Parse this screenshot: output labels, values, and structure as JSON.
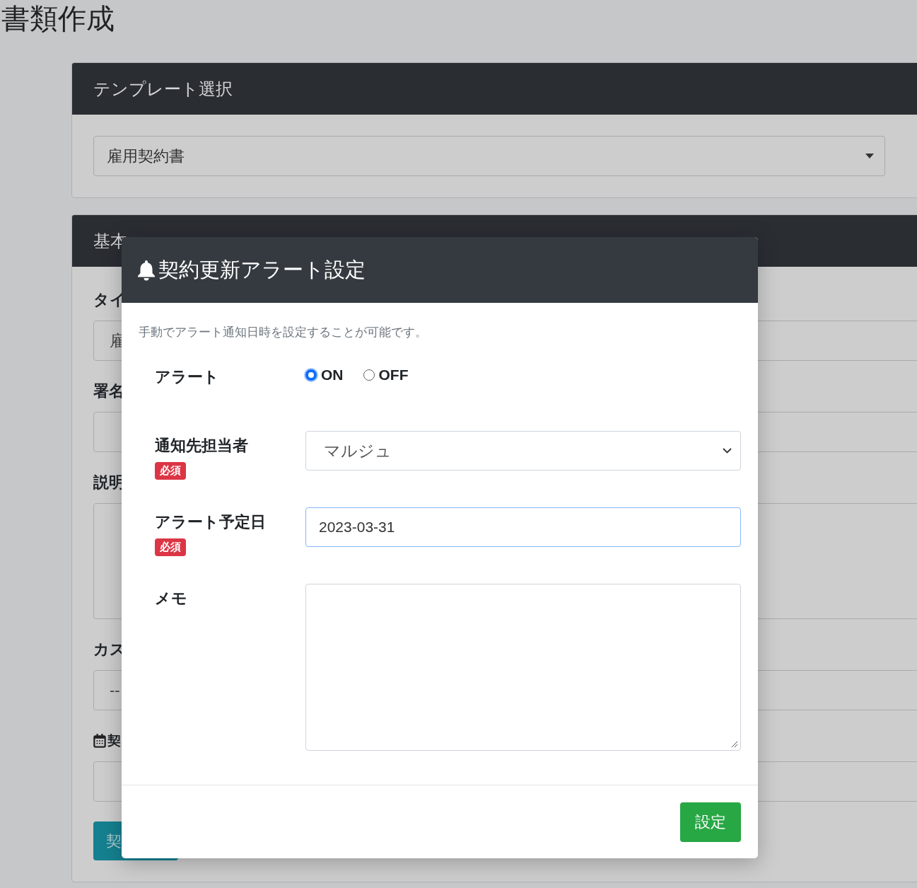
{
  "page_title": "書類作成",
  "template_card": {
    "title": "テンプレート選択",
    "select": {
      "value": "雇用契約書"
    }
  },
  "basic_card": {
    "title": "基本",
    "fields": [
      {
        "kind": "input",
        "label": "タイ",
        "value": "雇"
      },
      {
        "kind": "input",
        "label": "署名"
      },
      {
        "kind": "textarea",
        "label": "説明"
      },
      {
        "kind": "input",
        "label": "カス",
        "value": "--"
      },
      {
        "kind": "date",
        "label": "契"
      }
    ],
    "button": "契"
  },
  "modal": {
    "title": "契約更新アラート設定",
    "description": "手動でアラート通知日時を設定することが可能です。",
    "fields": [
      {
        "kind": "radio",
        "label": "アラート",
        "options": [
          {
            "label": "ON",
            "selected": true
          },
          {
            "label": "OFF",
            "selected": false
          }
        ]
      },
      {
        "kind": "select",
        "label": "通知先担当者",
        "badge": "必須",
        "value": "マルジュ"
      },
      {
        "kind": "date",
        "label": "アラート予定日",
        "badge": "必須",
        "value": "2023-03-31",
        "focused": true
      },
      {
        "kind": "textarea",
        "label": "メモ"
      }
    ],
    "submit": "設定"
  }
}
